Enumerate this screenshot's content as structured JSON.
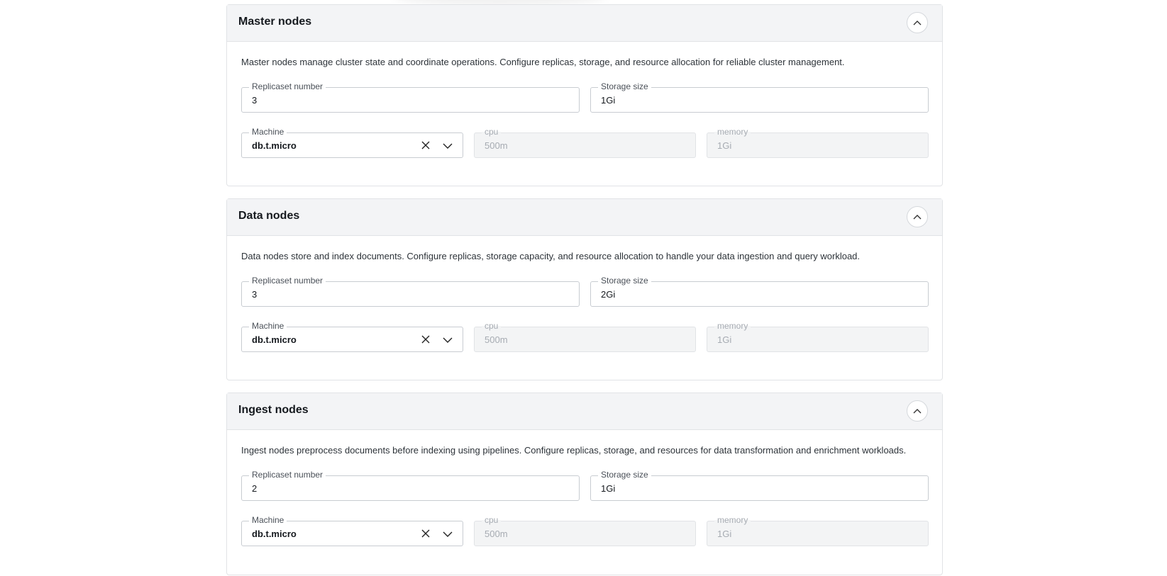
{
  "sections": [
    {
      "title": "Master nodes",
      "description": "Master nodes manage cluster state and coordinate operations. Configure replicas, storage, and resource allocation for reliable cluster management.",
      "replicaset": {
        "label": "Replicaset number",
        "value": "3"
      },
      "storage": {
        "label": "Storage size",
        "value": "1Gi"
      },
      "machine": {
        "label": "Machine",
        "value": "db.t.micro"
      },
      "cpu": {
        "label": "cpu",
        "value": "500m"
      },
      "memory": {
        "label": "memory",
        "value": "1Gi"
      }
    },
    {
      "title": "Data nodes",
      "description": "Data nodes store and index documents. Configure replicas, storage capacity, and resource allocation to handle your data ingestion and query workload.",
      "replicaset": {
        "label": "Replicaset number",
        "value": "3"
      },
      "storage": {
        "label": "Storage size",
        "value": "2Gi"
      },
      "machine": {
        "label": "Machine",
        "value": "db.t.micro"
      },
      "cpu": {
        "label": "cpu",
        "value": "500m"
      },
      "memory": {
        "label": "memory",
        "value": "1Gi"
      }
    },
    {
      "title": "Ingest nodes",
      "description": "Ingest nodes preprocess documents before indexing using pipelines. Configure replicas, storage, and resources for data transformation and enrichment workloads.",
      "replicaset": {
        "label": "Replicaset number",
        "value": "2"
      },
      "storage": {
        "label": "Storage size",
        "value": "1Gi"
      },
      "machine": {
        "label": "Machine",
        "value": "db.t.micro"
      },
      "cpu": {
        "label": "cpu",
        "value": "500m"
      },
      "memory": {
        "label": "memory",
        "value": "1Gi"
      }
    }
  ],
  "icons": {
    "collapse": "chevron-up-icon",
    "clear": "close-icon",
    "dropdown": "chevron-down-icon"
  }
}
